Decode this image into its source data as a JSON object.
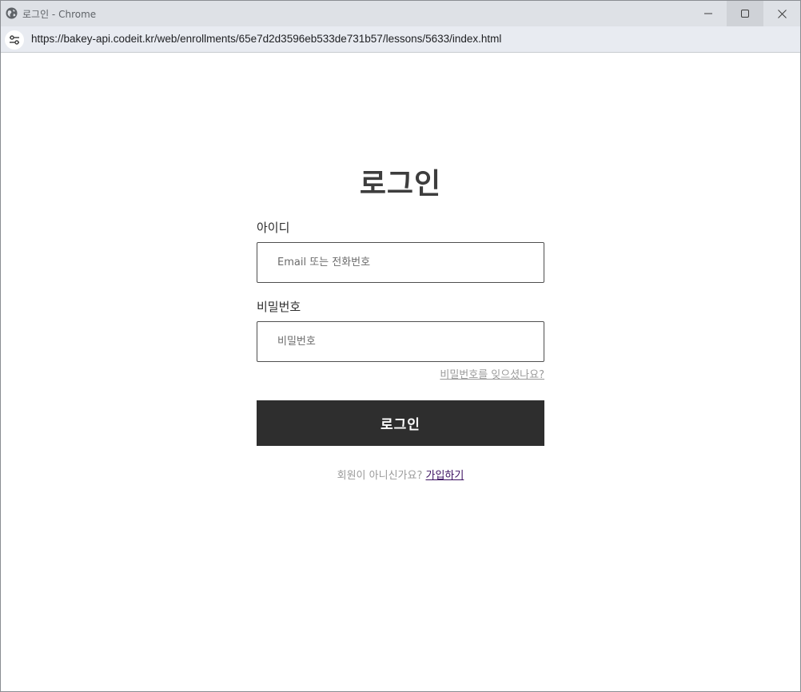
{
  "window": {
    "title": "로그인 - Chrome",
    "url": "https://bakey-api.codeit.kr/web/enrollments/65e7d2d3596eb533de731b57/lessons/5633/index.html",
    "icons": [
      "globe-icon",
      "minimize-icon",
      "maximize-icon",
      "close-icon",
      "site-info-icon"
    ]
  },
  "login": {
    "title": "로그인",
    "id_label": "아이디",
    "id_placeholder": "Email 또는 전화번호",
    "id_value": "",
    "password_label": "비밀번호",
    "password_placeholder": "비밀번호",
    "password_value": "",
    "forgot_password": "비밀번호를 잊으셨나요?",
    "submit_label": "로그인",
    "signup_prompt": "회원이 아니신가요?",
    "signup_link": "가입하기"
  },
  "colors": {
    "titlebar_bg": "#dee1e6",
    "addressbar_bg": "#e8ebf1",
    "button_bg": "#2e2e2e",
    "button_text": "#ffffff",
    "muted_text": "#9a9a9a",
    "visited_link": "#3b1060"
  }
}
